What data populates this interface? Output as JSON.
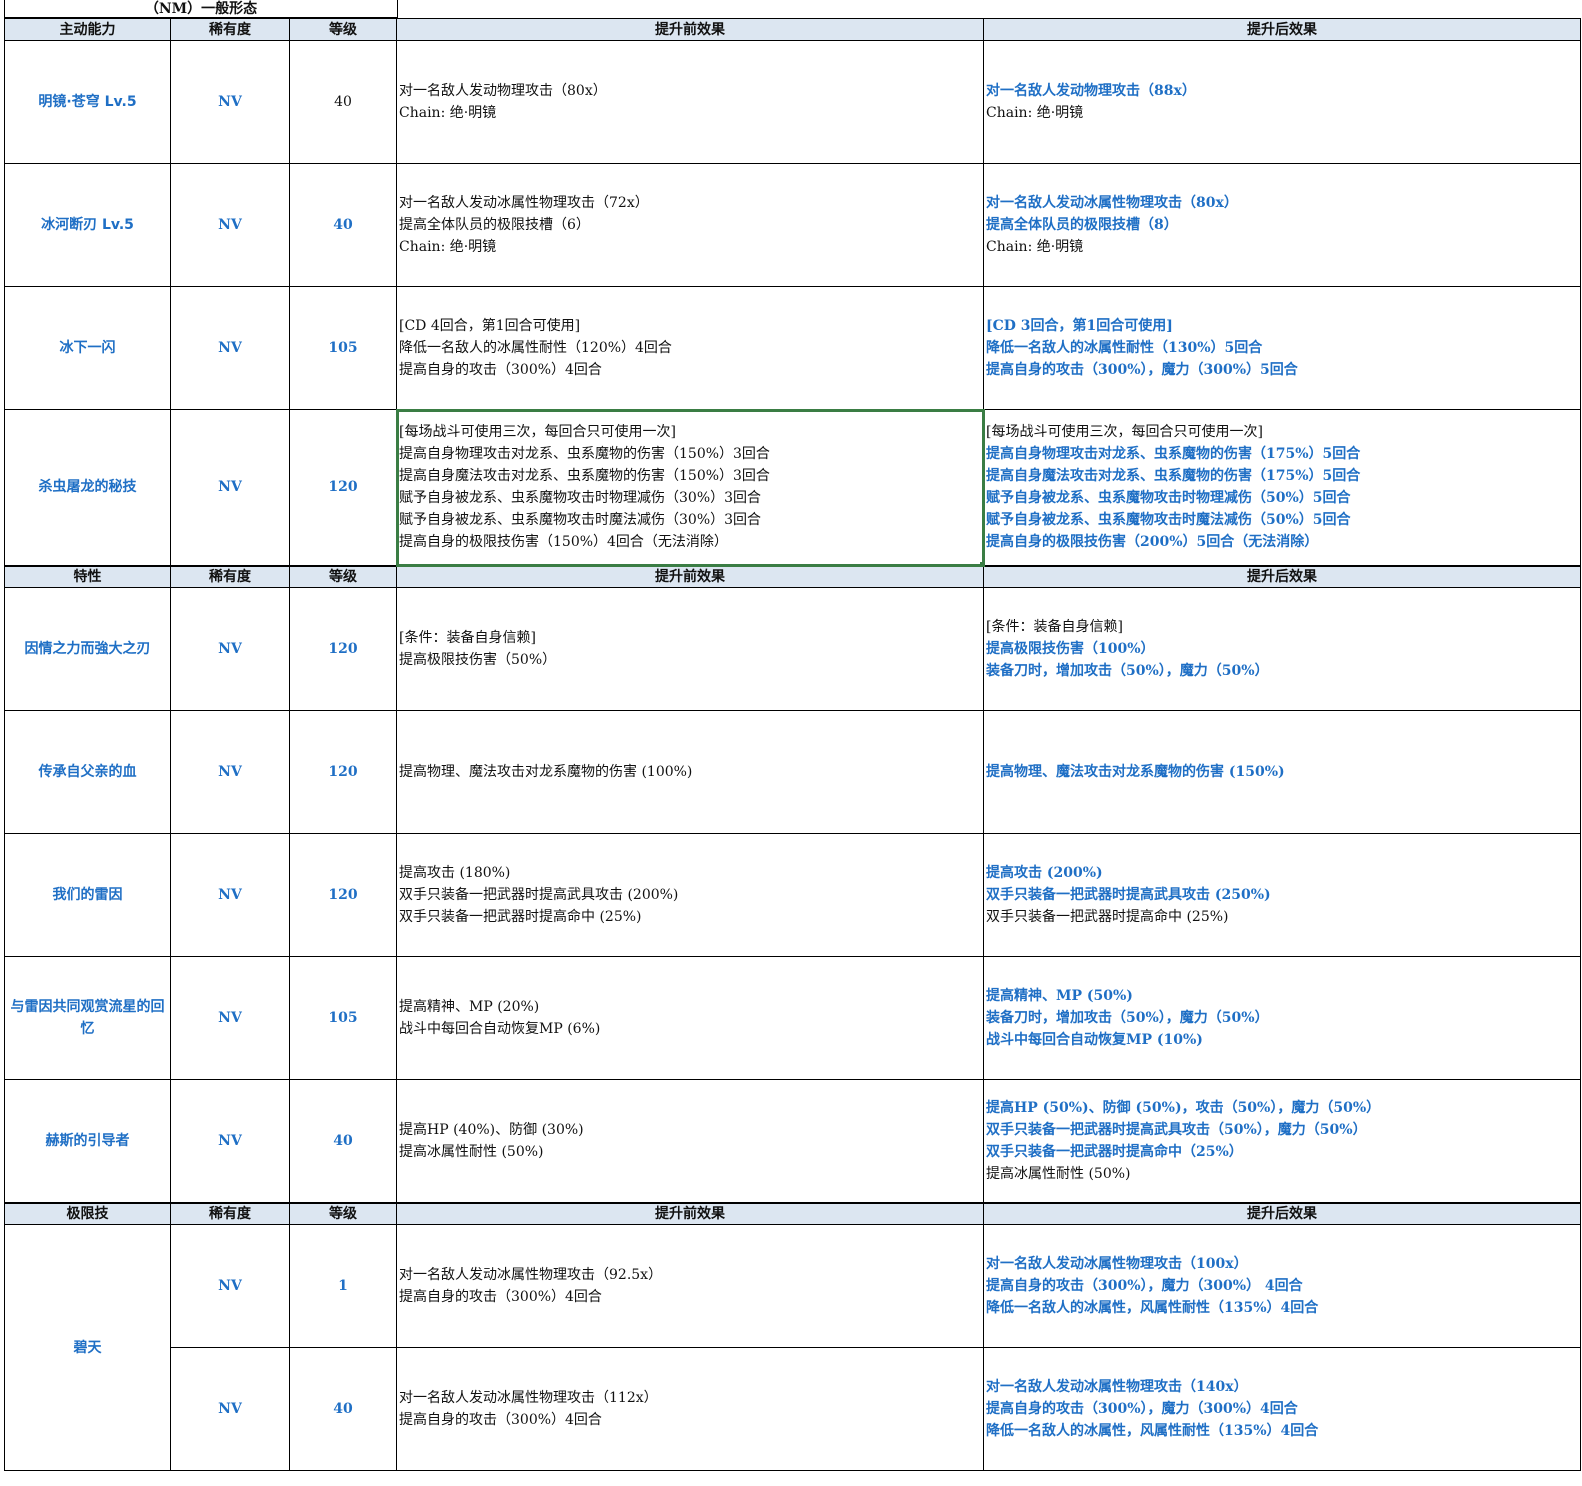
{
  "sheet_title": "（NM）一般形态",
  "colors": {
    "accent_blue": "#1f6fc5",
    "header_bg": "#dce6f1",
    "selection": "#3a7d44"
  },
  "sections": [
    {
      "header": [
        "主动能力",
        "稀有度",
        "等级",
        "提升前效果",
        "提升后效果"
      ],
      "rows": [
        {
          "name": "明镜·苍穹 Lv.5",
          "rarity": "NV",
          "level": "40",
          "level_style": "black",
          "before": [
            {
              "t": "对一名敌人发动物理攻击（80x）",
              "s": "n"
            },
            {
              "t": "Chain: 绝·明镜",
              "s": "n"
            }
          ],
          "after": [
            {
              "t": "对一名敌人发动物理攻击（88x）",
              "s": "b"
            },
            {
              "t": "Chain: 绝·明镜",
              "s": "n"
            }
          ]
        },
        {
          "name": "冰河断刃 Lv.5",
          "rarity": "NV",
          "level": "40",
          "level_style": "blue",
          "before": [
            {
              "t": "对一名敌人发动冰属性物理攻击（72x）",
              "s": "n"
            },
            {
              "t": "提高全体队员的极限技槽（6）",
              "s": "n"
            },
            {
              "t": "Chain: 绝·明镜",
              "s": "n"
            }
          ],
          "after": [
            {
              "t": "对一名敌人发动冰属性物理攻击（80x）",
              "s": "b"
            },
            {
              "t": "提高全体队员的极限技槽（8）",
              "s": "b"
            },
            {
              "t": "Chain: 绝·明镜",
              "s": "n"
            }
          ]
        },
        {
          "name": "冰下一闪",
          "rarity": "NV",
          "level": "105",
          "level_style": "blue",
          "before": [
            {
              "t": "[CD 4回合，第1回合可使用]",
              "s": "n"
            },
            {
              "t": "降低一名敌人的冰属性耐性（120%）4回合",
              "s": "n"
            },
            {
              "t": "提高自身的攻击（300%）4回合",
              "s": "n"
            }
          ],
          "after": [
            {
              "t": "[CD 3回合，第1回合可使用]",
              "s": "b"
            },
            {
              "t": "降低一名敌人的冰属性耐性（130%）5回合",
              "s": "b"
            },
            {
              "t": "提高自身的攻击（300%），魔力（300%）5回合",
              "s": "b"
            }
          ]
        },
        {
          "name": "杀虫屠龙的秘技",
          "rarity": "NV",
          "level": "120",
          "level_style": "blue",
          "selected": true,
          "before": [
            {
              "t": "[每场战斗可使用三次，每回合只可使用一次]",
              "s": "n"
            },
            {
              "t": "提高自身物理攻击对龙系、虫系魔物的伤害（150%）3回合",
              "s": "n"
            },
            {
              "t": "提高自身魔法攻击对龙系、虫系魔物的伤害（150%）3回合",
              "s": "n"
            },
            {
              "t": "赋予自身被龙系、虫系魔物攻击时物理减伤（30%）3回合",
              "s": "n"
            },
            {
              "t": "赋予自身被龙系、虫系魔物攻击时魔法减伤（30%）3回合",
              "s": "n"
            },
            {
              "t": "提高自身的极限技伤害（150%）4回合（无法消除）",
              "s": "n"
            }
          ],
          "after": [
            {
              "t": "[每场战斗可使用三次，每回合只可使用一次]",
              "s": "n"
            },
            {
              "t": "提高自身物理攻击对龙系、虫系魔物的伤害（175%）5回合",
              "s": "b"
            },
            {
              "t": "提高自身魔法攻击对龙系、虫系魔物的伤害（175%）5回合",
              "s": "b"
            },
            {
              "t": "赋予自身被龙系、虫系魔物攻击时物理减伤（50%）5回合",
              "s": "b"
            },
            {
              "t": "赋予自身被龙系、虫系魔物攻击时魔法减伤（50%）5回合",
              "s": "b"
            },
            {
              "t": "提高自身的极限技伤害（200%）5回合（无法消除）",
              "s": "b"
            }
          ]
        }
      ]
    },
    {
      "header": [
        "特性",
        "稀有度",
        "等级",
        "提升前效果",
        "提升后效果"
      ],
      "rows": [
        {
          "name": "因情之力而強大之刃",
          "rarity": "NV",
          "level": "120",
          "level_style": "blue",
          "before": [
            {
              "t": "[条件：装备自身信赖]",
              "s": "n"
            },
            {
              "t": "提高极限技伤害（50%）",
              "s": "n"
            }
          ],
          "after": [
            {
              "t": "[条件：装备自身信赖]",
              "s": "n"
            },
            {
              "t": "提高极限技伤害（100%）",
              "s": "b"
            },
            {
              "t": "装备刀时，增加攻击（50%），魔力（50%）",
              "s": "b"
            }
          ]
        },
        {
          "name": "传承自父亲的血",
          "rarity": "NV",
          "level": "120",
          "level_style": "blue",
          "before": [
            {
              "t": "提高物理、魔法攻击对龙系魔物的伤害 (100%)",
              "s": "n"
            }
          ],
          "after": [
            {
              "t": "提高物理、魔法攻击对龙系魔物的伤害 (150%)",
              "s": "b"
            }
          ]
        },
        {
          "name": "我们的雷因",
          "rarity": "NV",
          "level": "120",
          "level_style": "blue",
          "before": [
            {
              "t": "提高攻击 (180%)",
              "s": "n"
            },
            {
              "t": "双手只装备一把武器时提高武具攻击 (200%)",
              "s": "n"
            },
            {
              "t": "双手只装备一把武器时提高命中 (25%)",
              "s": "n"
            }
          ],
          "after": [
            {
              "t": "提高攻击 (200%)",
              "s": "b"
            },
            {
              "t": "双手只装备一把武器时提高武具攻击 (250%)",
              "s": "b"
            },
            {
              "t": "双手只装备一把武器时提高命中 (25%)",
              "s": "n"
            }
          ]
        },
        {
          "name": "与雷因共同观赏流星的回忆",
          "rarity": "NV",
          "level": "105",
          "level_style": "blue",
          "before": [
            {
              "t": "提高精神、MP (20%)",
              "s": "n"
            },
            {
              "t": "战斗中每回合自动恢复MP (6%)",
              "s": "n"
            }
          ],
          "after": [
            {
              "t": "提高精神、MP (50%)",
              "s": "b"
            },
            {
              "t": "装备刀时，增加攻击（50%），魔力（50%）",
              "s": "b"
            },
            {
              "t": "战斗中每回合自动恢复MP (10%)",
              "s": "b"
            }
          ]
        },
        {
          "name": "赫斯的引导者",
          "rarity": "NV",
          "level": "40",
          "level_style": "blue",
          "before": [
            {
              "t": "提高HP (40%)、防御 (30%)",
              "s": "n"
            },
            {
              "t": "提高冰属性耐性 (50%)",
              "s": "n"
            }
          ],
          "after": [
            {
              "t": "提高HP (50%)、防御 (50%)，攻击（50%），魔力（50%）",
              "s": "b"
            },
            {
              "t": "双手只装备一把武器时提高武具攻击（50%），魔力（50%）",
              "s": "b"
            },
            {
              "t": "双手只装备一把武器时提高命中（25%）",
              "s": "b"
            },
            {
              "t": "提高冰属性耐性 (50%)",
              "s": "n"
            }
          ]
        }
      ]
    },
    {
      "header": [
        "极限技",
        "稀有度",
        "等级",
        "提升前效果",
        "提升后效果"
      ],
      "rows": [
        {
          "name": "碧天",
          "rarity": "NV",
          "level": "1",
          "level_style": "blue",
          "before": [
            {
              "t": "对一名敌人发动冰属性物理攻击（92.5x）",
              "s": "n"
            },
            {
              "t": "提高自身的攻击（300%）4回合",
              "s": "n"
            }
          ],
          "after": [
            {
              "t": "对一名敌人发动冰属性物理攻击（100x）",
              "s": "b"
            },
            {
              "t": "提高自身的攻击（300%），魔力（300%） 4回合",
              "s": "b"
            },
            {
              "t": "降低一名敌人的冰属性，风属性耐性（135%）4回合",
              "s": "b"
            }
          ]
        },
        {
          "name": "碧天",
          "rarity": "NV",
          "level": "40",
          "level_style": "blue",
          "before": [
            {
              "t": "对一名敌人发动冰属性物理攻击（112x）",
              "s": "n"
            },
            {
              "t": "提高自身的攻击（300%）4回合",
              "s": "n"
            }
          ],
          "after": [
            {
              "t": "对一名敌人发动冰属性物理攻击（140x）",
              "s": "b"
            },
            {
              "t": "提高自身的攻击（300%），魔力（300%）4回合",
              "s": "b"
            },
            {
              "t": "降低一名敌人的冰属性，风属性耐性（135%）4回合",
              "s": "b"
            }
          ]
        }
      ]
    }
  ]
}
